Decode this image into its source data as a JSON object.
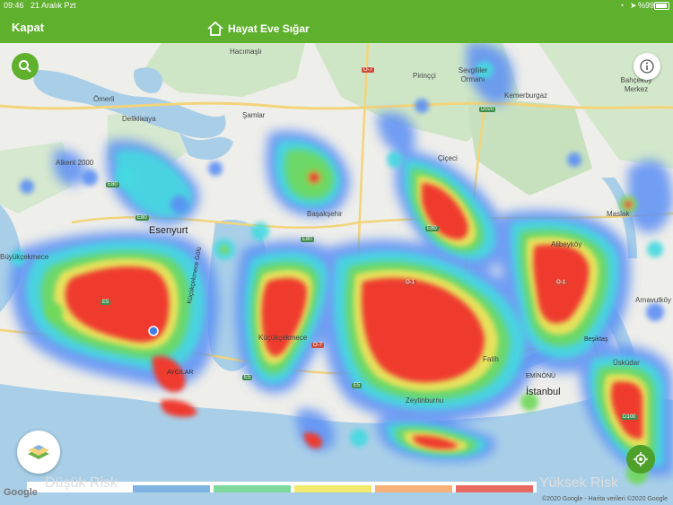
{
  "status_bar": {
    "time": "09:46",
    "date": "21 Aralık Pzt",
    "battery": "%99"
  },
  "nav": {
    "close_label": "Kapat",
    "app_title": "Hayat Eve Sığar"
  },
  "map": {
    "places": [
      {
        "name": "Hacımaşlı",
        "cls": ""
      },
      {
        "name": "Pirinççi",
        "cls": ""
      },
      {
        "name": "Sevgililer Ormanı",
        "cls": ""
      },
      {
        "name": "Ömerli",
        "cls": ""
      },
      {
        "name": "Şamlar",
        "cls": ""
      },
      {
        "name": "Kemerburgaz",
        "cls": ""
      },
      {
        "name": "Bahçeköy Merkez",
        "cls": ""
      },
      {
        "name": "Delikliкaya",
        "cls": ""
      },
      {
        "name": "Alkent 2000",
        "cls": ""
      },
      {
        "name": "Çiçeci",
        "cls": ""
      },
      {
        "name": "Başakşehir",
        "cls": ""
      },
      {
        "name": "Maslak",
        "cls": ""
      },
      {
        "name": "Esenyurt",
        "cls": "big"
      },
      {
        "name": "Alibeyköy",
        "cls": ""
      },
      {
        "name": "Büyükçekmece",
        "cls": ""
      },
      {
        "name": "Küçükçekmece Gölü",
        "cls": "dark"
      },
      {
        "name": "Arnavutköy",
        "cls": ""
      },
      {
        "name": "Küçükçekmece",
        "cls": ""
      },
      {
        "name": "Beşiktaş",
        "cls": "dark"
      },
      {
        "name": "AVCILAR",
        "cls": "dark"
      },
      {
        "name": "Fatih",
        "cls": ""
      },
      {
        "name": "EMİNÖNÜ",
        "cls": "dark"
      },
      {
        "name": "Üsküdar",
        "cls": ""
      },
      {
        "name": "İstanbul",
        "cls": "big"
      },
      {
        "name": "Zeytinburnu",
        "cls": ""
      }
    ],
    "roads": [
      {
        "name": "O-7",
        "color": "red"
      },
      {
        "name": "D020",
        "color": "green"
      },
      {
        "name": "E80",
        "color": "green"
      },
      {
        "name": "E80",
        "color": "green"
      },
      {
        "name": "E80",
        "color": "green"
      },
      {
        "name": "E80",
        "color": "green"
      },
      {
        "name": "E5",
        "color": "green"
      },
      {
        "name": "E5",
        "color": "green"
      },
      {
        "name": "E5",
        "color": "green"
      },
      {
        "name": "O-7",
        "color": "red"
      },
      {
        "name": "O-1",
        "color": "red"
      },
      {
        "name": "O-1",
        "color": "red"
      },
      {
        "name": "D100",
        "color": "green"
      }
    ],
    "attribution": "©2020 Google - Harita verileri ©2020 Google",
    "google_logo": "Google"
  },
  "legend": {
    "low_label": "Düşük Risk",
    "high_label": "Yüksek Risk",
    "colors": [
      "#7fb4e2",
      "#7fd99c",
      "#f2ea6e",
      "#f5b27a",
      "#e76b62"
    ]
  },
  "buttons": {
    "search_icon": "search-icon",
    "info_icon": "info-icon",
    "layers_icon": "map-layers-icon",
    "locate_icon": "locate-icon"
  }
}
